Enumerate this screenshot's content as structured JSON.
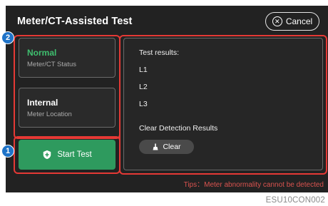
{
  "header": {
    "title": "Meter/CT-Assisted Test",
    "cancel_label": "Cancel"
  },
  "status_cards": [
    {
      "value": "Normal",
      "label": "Meter/CT Status",
      "value_color": "#3fbf6f"
    },
    {
      "value": "Internal",
      "label": "Meter Location",
      "value_color": "#ffffff"
    }
  ],
  "start_button": {
    "label": "Start Test",
    "icon": "shield-plus-icon"
  },
  "results": {
    "heading": "Test results:",
    "lines": [
      "L1",
      "L2",
      "L3"
    ],
    "clear_section_label": "Clear Detection Results",
    "clear_button_label": "Clear",
    "clear_icon": "broom-icon"
  },
  "tips": "Tips：Meter abnormality cannot be detected",
  "annotations": {
    "badge_1": "1",
    "badge_2": "2"
  },
  "figure_code": "ESU10CON002",
  "colors": {
    "background": "#222222",
    "accent_green": "#2e9a5e",
    "status_green": "#3fbf6f",
    "highlight_red": "#e53935",
    "tips_red": "#d9534f",
    "badge_blue": "#1e73c8"
  }
}
